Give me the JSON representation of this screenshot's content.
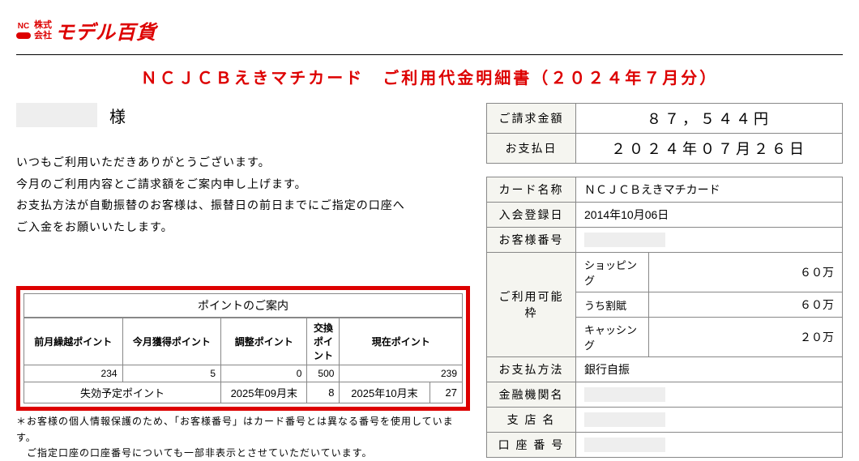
{
  "logo": {
    "nc": "NC",
    "kk_line1": "株式",
    "kk_line2": "会社",
    "name": "モデル百貨"
  },
  "title": "ＮＣＪＣＢえきマチカード　ご利用代金明細書（２０２４年７月分）",
  "customer_sama": "様",
  "intro": {
    "l1": "いつもご利用いただきありがとうございます。",
    "l2": "今月のご利用内容とご請求額をご案内申し上げます。",
    "l3": "お支払方法が自動振替のお客様は、振替日の前日までにご指定の口座へ",
    "l4": "ご入金をお願いいたします。"
  },
  "points": {
    "title": "ポイントのご案内",
    "headers": {
      "carry": "前月繰越ポイント",
      "earned": "今月獲得ポイント",
      "adjust": "調整ポイント",
      "exchange": "交換ポイント",
      "current": "現在ポイント"
    },
    "values": {
      "carry": "234",
      "earned": "5",
      "adjust": "0",
      "exchange": "500",
      "current": "239"
    },
    "expire": {
      "label": "失効予定ポイント",
      "d1": "2025年09月末",
      "v1": "8",
      "d2": "2025年10月末",
      "v2": "27"
    }
  },
  "summary": {
    "bill_label": "ご請求金額",
    "bill_value": "８７，５４４円",
    "pay_label": "お支払日",
    "pay_value": "２０２４年０７月２６日"
  },
  "card": {
    "name_label": "カード名称",
    "name_value": "ＮＣＪＣＢえきマチカード",
    "reg_label": "入会登録日",
    "reg_value": "2014年10月06日",
    "cust_label": "お客様番号",
    "limit_label": "ご利用可能枠",
    "shopping_label": "ショッピング",
    "shopping_value": "６０万",
    "installment_label": "うち割賦",
    "installment_value": "６０万",
    "cashing_label": "キャッシング",
    "cashing_value": "２０万",
    "method_label": "お支払方法",
    "method_value": "銀行自振",
    "bank_label": "金融機関名",
    "branch_label": "支 店 名",
    "account_label": "口 座 番 号"
  },
  "notes": {
    "n1": "＊お客様の個人情報保護のため、「お客様番号」はカード番号とは異なる番号を使用しています。",
    "n2": "　ご指定口座の口座番号についても一部非表示とさせていただいています。"
  }
}
